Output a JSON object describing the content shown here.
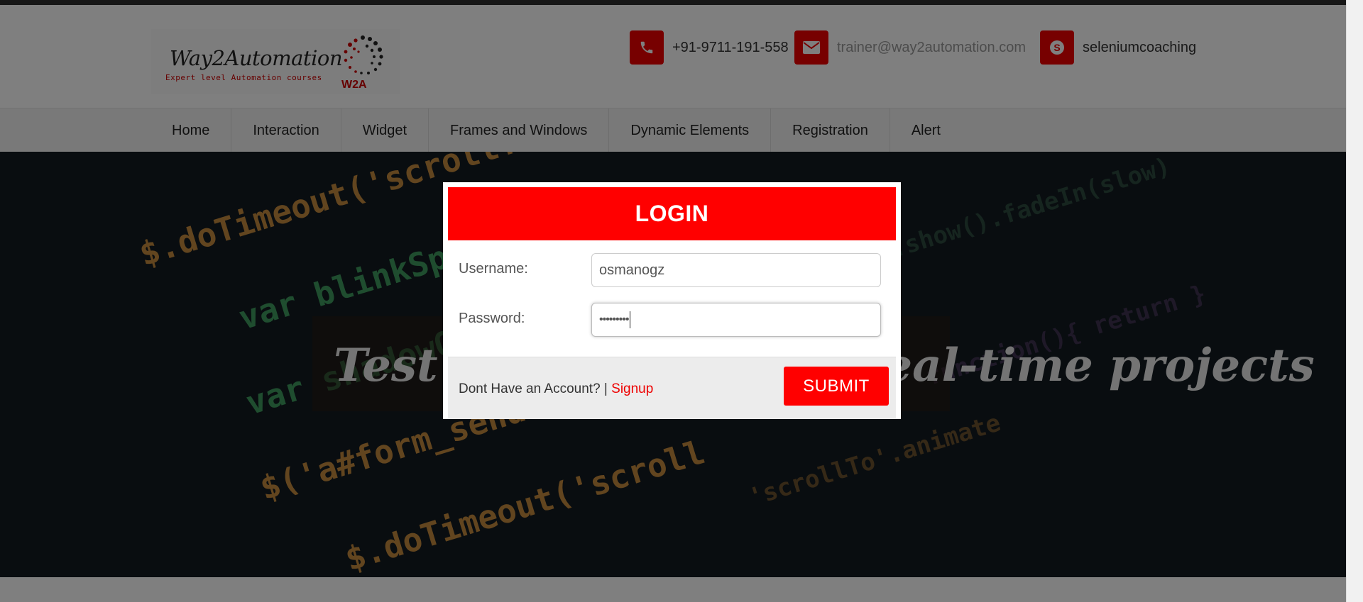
{
  "header": {
    "logo": {
      "title": "Way2Automation",
      "subtitle": "Expert level Automation courses",
      "mark_text": "W2A"
    },
    "contacts": [
      {
        "icon": "phone-icon",
        "text": "+91-9711-191-558"
      },
      {
        "icon": "envelope-icon",
        "text": "trainer@way2automation.com"
      },
      {
        "icon": "skype-icon",
        "text": "seleniumcoaching"
      }
    ]
  },
  "nav": {
    "items": [
      "Home",
      "Interaction",
      "Widget",
      "Frames and Windows",
      "Dynamic Elements",
      "Registration",
      "Alert"
    ]
  },
  "hero": {
    "title": "Test your skills with real-time projects"
  },
  "login": {
    "title": "LOGIN",
    "username_label": "Username:",
    "username_value": "osmanogz",
    "password_label": "Password:",
    "password_value": "•••••••••",
    "account_prompt": "Dont Have an Account? |",
    "signup_label": "Signup",
    "submit_label": "SUBMIT"
  },
  "colors": {
    "accent": "#ff0000",
    "overlay": "rgba(0,0,0,0.5)"
  }
}
